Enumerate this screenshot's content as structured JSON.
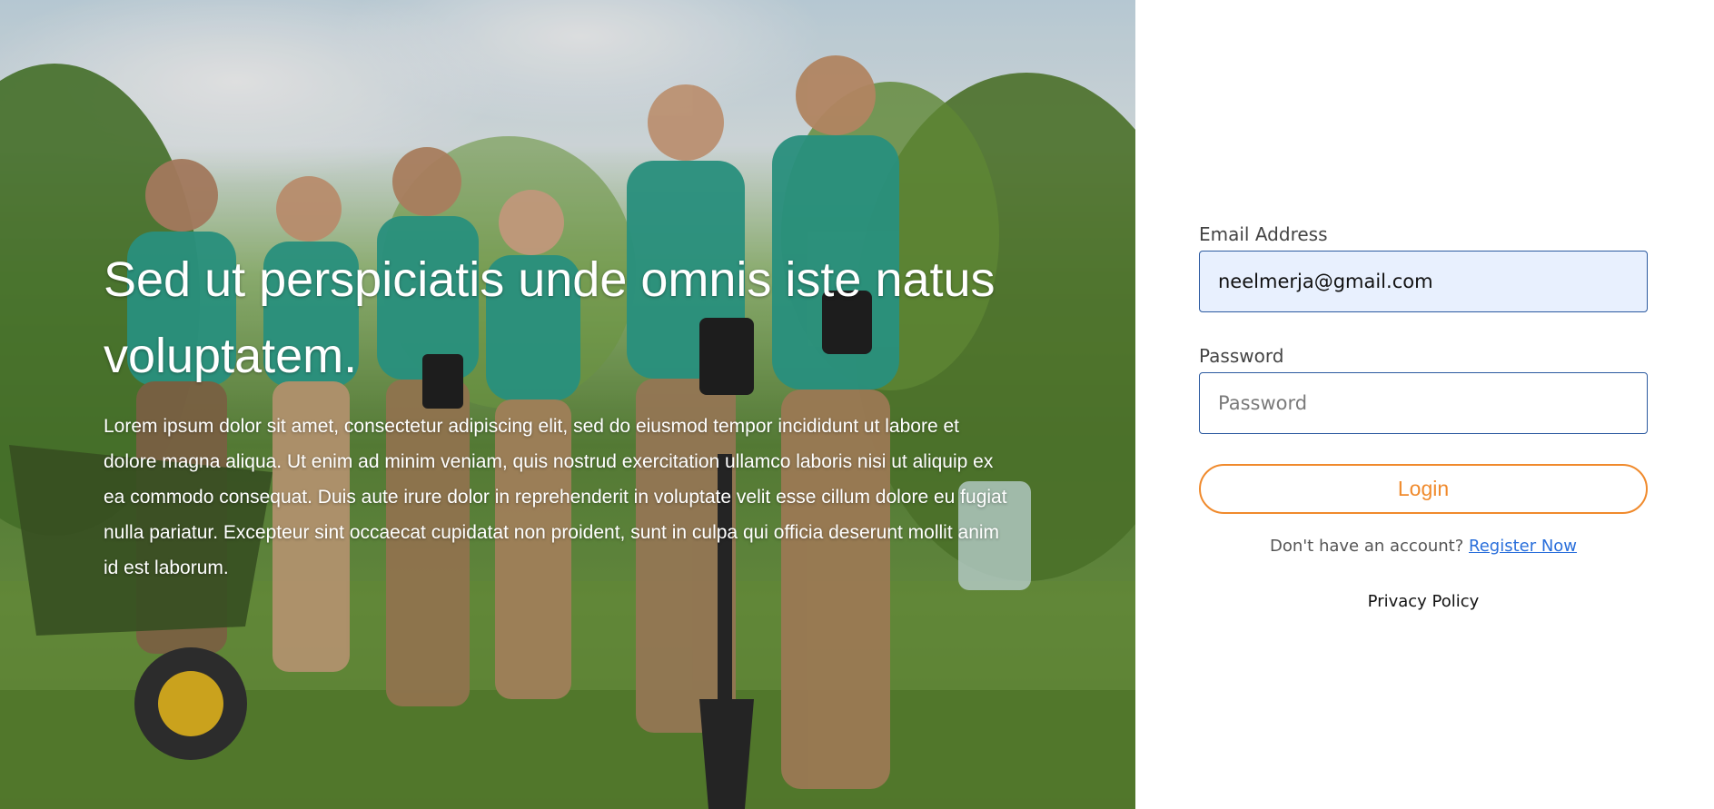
{
  "hero": {
    "title": "Sed ut perspiciatis unde omnis iste natus voluptatem.",
    "body": "Lorem ipsum dolor sit amet, consectetur adipiscing elit, sed do eiusmod tempor incididunt ut labore et dolore magna aliqua. Ut enim ad minim veniam, quis nostrud exercitation ullamco laboris nisi ut aliquip ex ea commodo consequat. Duis aute irure dolor in reprehenderit in voluptate velit esse cillum dolore eu fugiat nulla pariatur. Excepteur sint occaecat cupidatat non proident, sunt in culpa qui officia deserunt mollit anim id est laborum."
  },
  "login": {
    "email_label": "Email Address",
    "email_value": "neelmerja@gmail.com",
    "password_label": "Password",
    "password_placeholder": "Password",
    "login_button": "Login",
    "register_prompt": "Don't have an account?",
    "register_link": "Register Now",
    "privacy_link": "Privacy Policy"
  },
  "colors": {
    "accent": "#f08a2c",
    "input_border": "#2c5aa0",
    "link": "#2a6fdb",
    "autofill_bg": "#e8f0fe"
  }
}
